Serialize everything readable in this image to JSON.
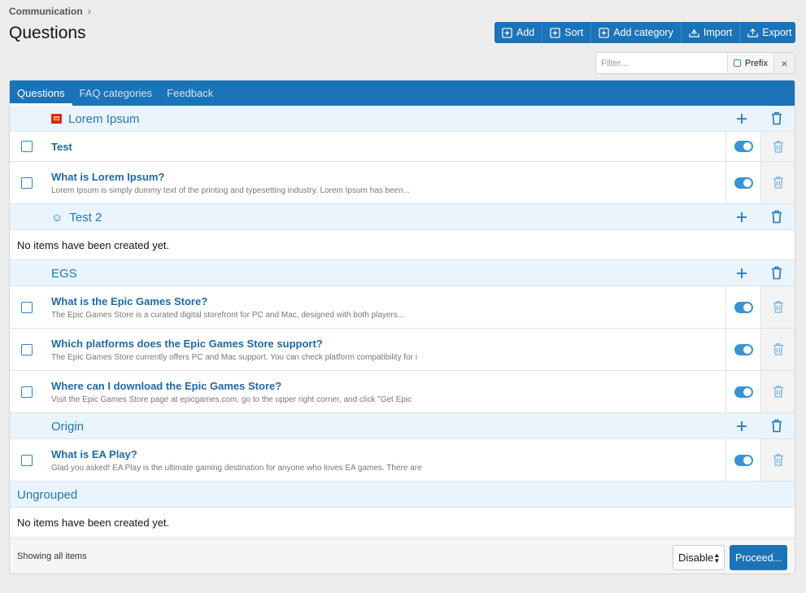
{
  "breadcrumb": {
    "items": [
      "Communication"
    ]
  },
  "page": {
    "title": "Questions"
  },
  "toolbar": {
    "buttons": [
      {
        "label": "Add",
        "icon": "plus-square-icon"
      },
      {
        "label": "Sort",
        "icon": "plus-square-icon"
      },
      {
        "label": "Add category",
        "icon": "plus-square-icon"
      },
      {
        "label": "Import",
        "icon": "import-icon"
      },
      {
        "label": "Export",
        "icon": "export-icon"
      }
    ]
  },
  "filter": {
    "placeholder": "Filter...",
    "prefix_label": "Prefix",
    "clear_label": "×"
  },
  "tabs": [
    {
      "label": "Questions",
      "active": true
    },
    {
      "label": "FAQ categories",
      "active": false
    },
    {
      "label": "Feedback",
      "active": false
    }
  ],
  "categories": [
    {
      "title": "Lorem Ipsum",
      "icon": "lorem-ipsum-thumbnail",
      "items": [
        {
          "title": "Test",
          "desc": ""
        },
        {
          "title": "What is Lorem Ipsum?",
          "desc": "Lorem Ipsum is simply dummy text of the printing and typesetting industry. Lorem Ipsum has been..."
        }
      ]
    },
    {
      "title": "Test 2",
      "icon": "smiley-icon",
      "items": [],
      "empty_text": "No items have been created yet."
    },
    {
      "title": "EGS",
      "items": [
        {
          "title": "What is the Epic Games Store?",
          "desc": "The Epic Games Store is a curated digital storefront for PC and Mac, designed with both players..."
        },
        {
          "title": "Which platforms does the Epic Games Store support?",
          "desc": "The Epic Games Store currently offers PC and Mac support. You can check platform compatibility for i"
        },
        {
          "title": "Where can I download the Epic Games Store?",
          "desc": "Visit the Epic Games Store page at epicgames.com, go to the upper right corner, and click \"Get Epic"
        }
      ]
    },
    {
      "title": "Origin",
      "items": [
        {
          "title": "What is EA Play?",
          "desc": "Glad you asked! EA Play is the ultimate gaming destination for anyone who loves EA games. There are"
        }
      ]
    }
  ],
  "ungrouped": {
    "title": "Ungrouped",
    "empty_text": "No items have been created yet."
  },
  "footer": {
    "status": "Showing all items",
    "action_select": "Disable",
    "proceed_label": "Proceed..."
  },
  "colors": {
    "accent": "#1b73b8",
    "category_bg": "#e9f4fc",
    "link": "#2069a6"
  }
}
